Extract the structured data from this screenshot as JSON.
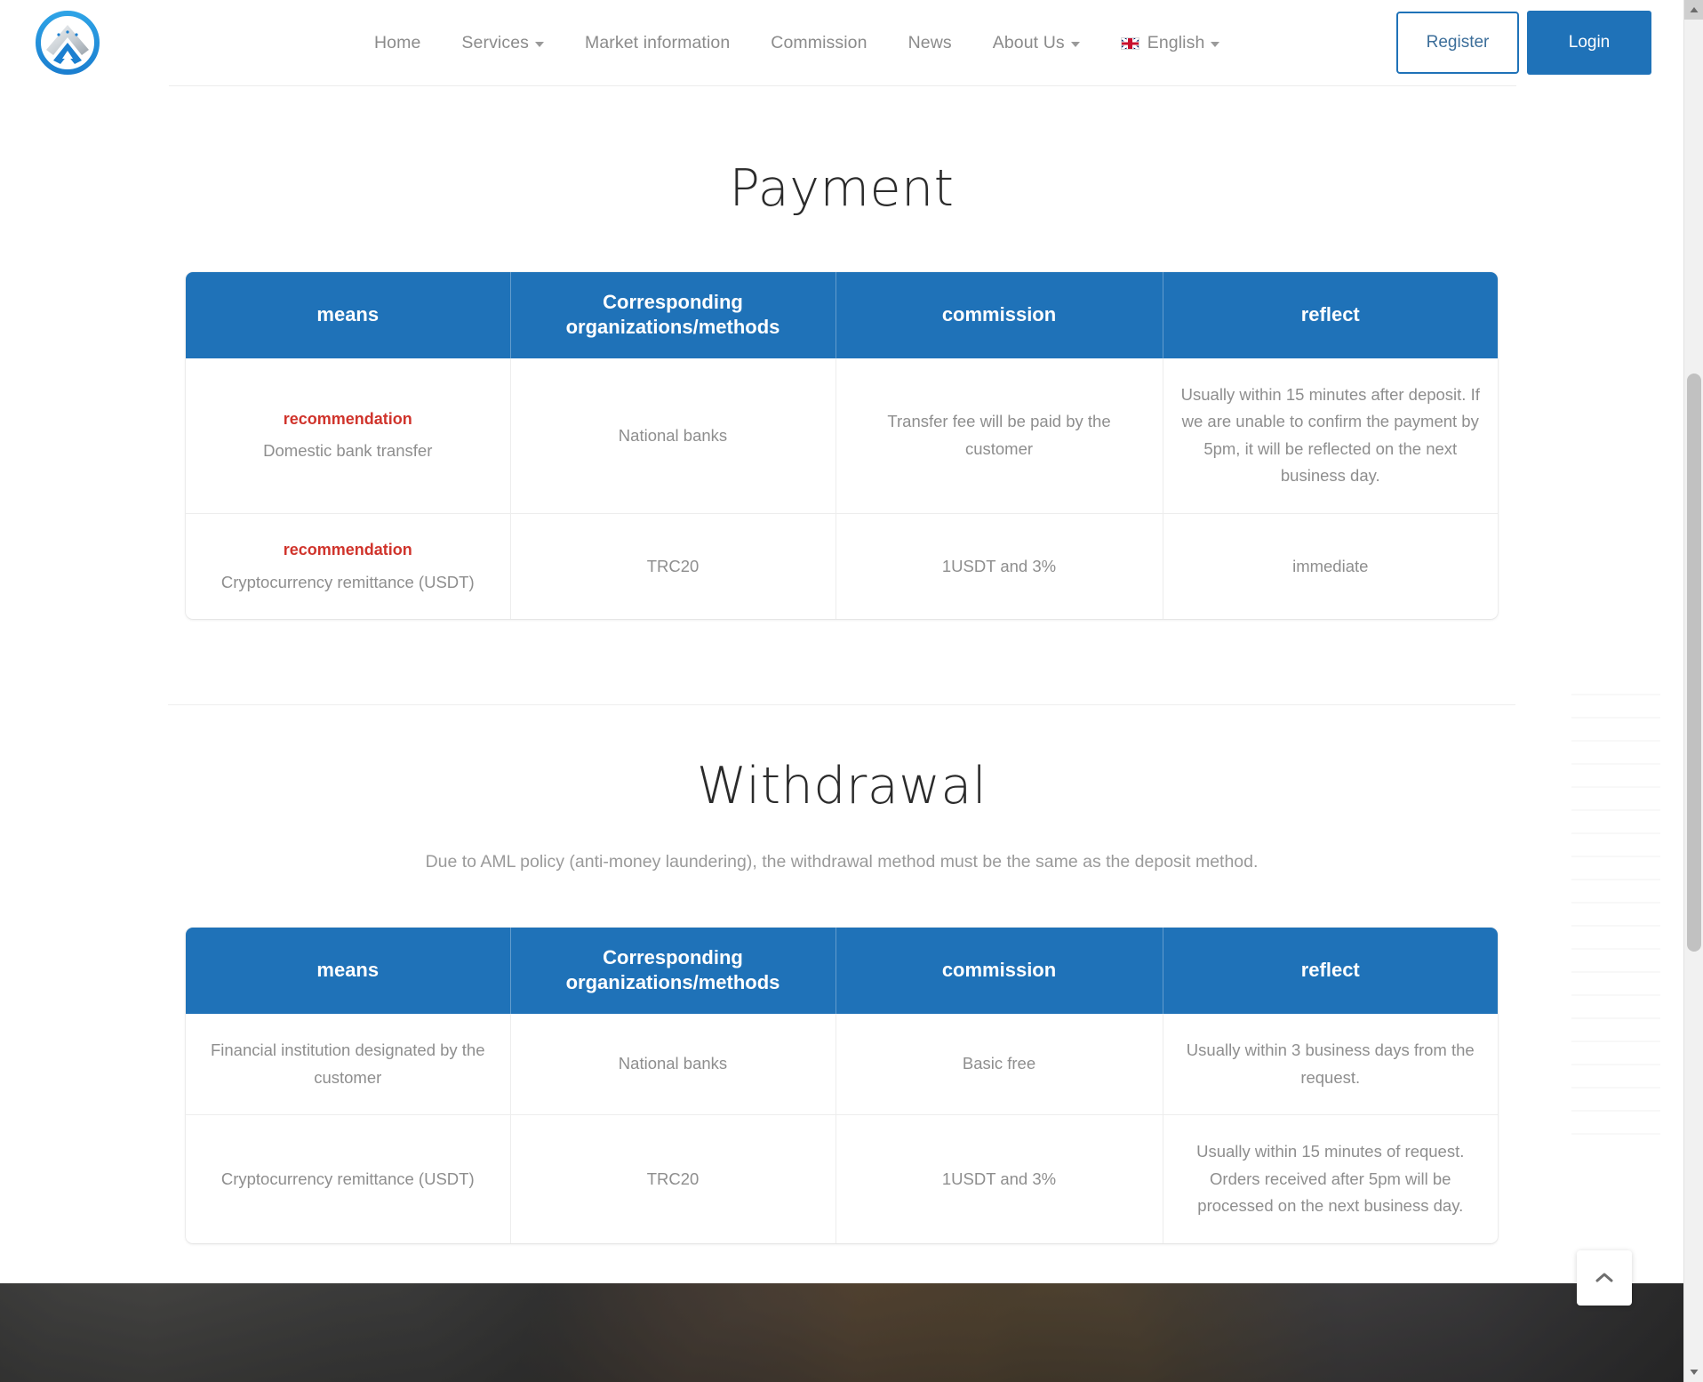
{
  "header": {
    "logo_name": "site-logo",
    "nav": [
      {
        "label": "Home",
        "has_dropdown": false
      },
      {
        "label": "Services",
        "has_dropdown": true
      },
      {
        "label": "Market information",
        "has_dropdown": false
      },
      {
        "label": "Commission",
        "has_dropdown": false
      },
      {
        "label": "News",
        "has_dropdown": false
      },
      {
        "label": "About Us",
        "has_dropdown": true
      }
    ],
    "language": {
      "label": "English",
      "flag": "uk-flag-icon",
      "has_dropdown": true
    },
    "register_label": "Register",
    "login_label": "Login"
  },
  "payment": {
    "title": "Payment",
    "columns": [
      "means",
      "Corresponding organizations/methods",
      "commission",
      "reflect"
    ],
    "rows": [
      {
        "badge": "recommendation",
        "means": "Domestic bank transfer",
        "organization": "National banks",
        "commission": "Transfer fee will be paid by the customer",
        "reflect": "Usually within 15 minutes after deposit. If we are unable to confirm the payment by 5pm, it will be reflected on the next business day."
      },
      {
        "badge": "recommendation",
        "means": "Cryptocurrency remittance (USDT)",
        "organization": "TRC20",
        "commission": "1USDT and 3%",
        "reflect": "immediate"
      }
    ]
  },
  "withdrawal": {
    "title": "Withdrawal",
    "note": "Due to AML policy (anti-money laundering), the withdrawal method must be the same as the deposit method.",
    "columns": [
      "means",
      "Corresponding organizations/methods",
      "commission",
      "reflect"
    ],
    "rows": [
      {
        "means": "Financial institution designated by the customer",
        "organization": "National banks",
        "commission": "Basic free",
        "reflect": "Usually within 3 business days from the request."
      },
      {
        "means": "Cryptocurrency remittance (USDT)",
        "organization": "TRC20",
        "commission": "1USDT and 3%",
        "reflect": "Usually within 15 minutes of request. Orders received after 5pm will be processed on the next business day."
      }
    ]
  },
  "controls": {
    "scroll_top_icon": "chevron-up-icon",
    "scrollbar_up_icon": "scrollbar-arrow-up",
    "scrollbar_down_icon": "scrollbar-arrow-down"
  },
  "colors": {
    "brand_blue": "#1f72b8",
    "accent_red": "#d0342c",
    "body_gray": "#8e8e8e",
    "title_dark": "#2b2b2b"
  }
}
